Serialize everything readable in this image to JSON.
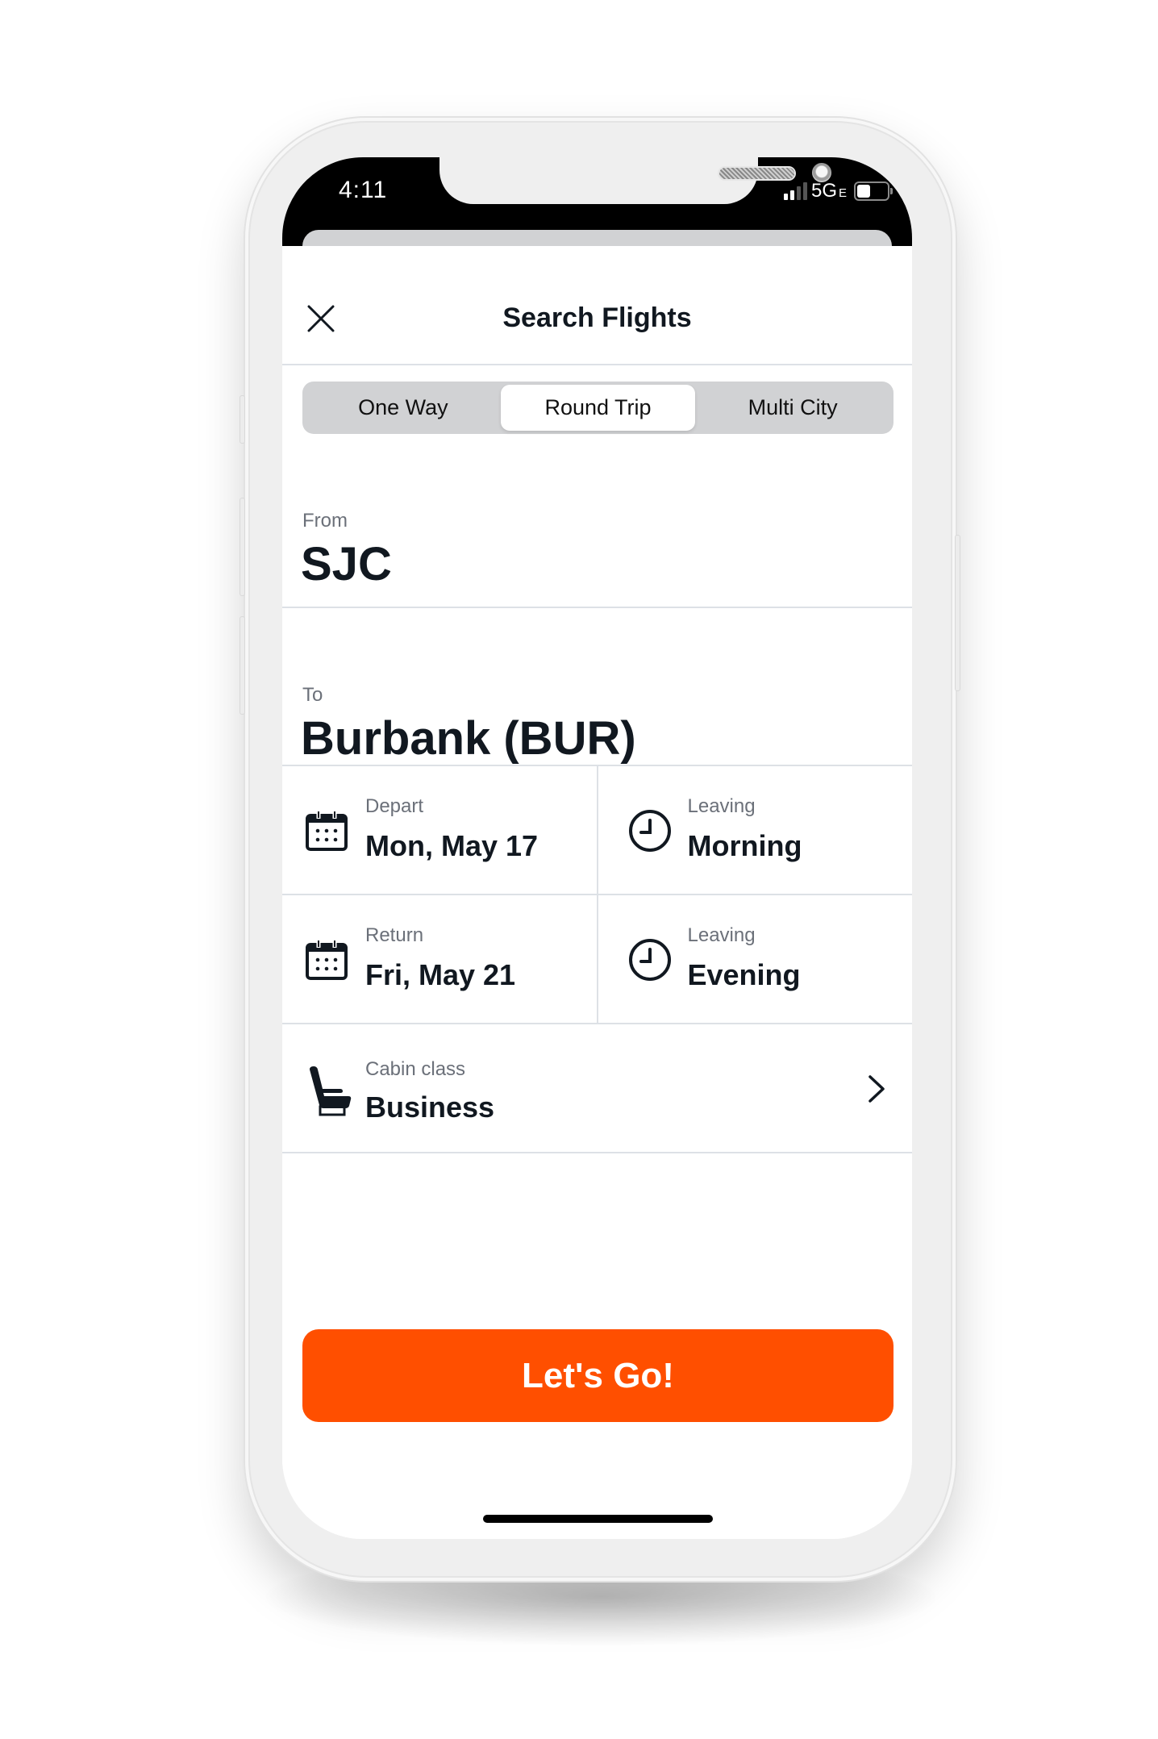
{
  "status_bar": {
    "time": "4:11",
    "network": "5G",
    "network_suffix": "E",
    "signal_bars_active": 2,
    "signal_bars_total": 4,
    "battery_level": 0.4
  },
  "header": {
    "title": "Search Flights",
    "close_icon": "close-icon"
  },
  "trip_type": {
    "options": [
      "One Way",
      "Round Trip",
      "Multi City"
    ],
    "selected": "Round Trip"
  },
  "from": {
    "label": "From",
    "value": "SJC"
  },
  "to": {
    "label": "To",
    "value": "Burbank (BUR)"
  },
  "depart": {
    "label": "Depart",
    "value": "Mon, May 17",
    "icon": "calendar-icon"
  },
  "depart_time": {
    "label": "Leaving",
    "value": "Morning",
    "icon": "clock-icon"
  },
  "return": {
    "label": "Return",
    "value": "Fri, May 21",
    "icon": "calendar-icon"
  },
  "return_time": {
    "label": "Leaving",
    "value": "Evening",
    "icon": "clock-icon"
  },
  "cabin": {
    "label": "Cabin class",
    "value": "Business",
    "icon": "seat-icon",
    "chevron": "chevron-right-icon"
  },
  "cta": {
    "label": "Let's Go!"
  },
  "colors": {
    "accent": "#FF4F00",
    "text_primary": "#111820",
    "text_secondary": "#6B7079",
    "divider": "#DDE1E6",
    "segment_bg": "#D1D2D4"
  }
}
